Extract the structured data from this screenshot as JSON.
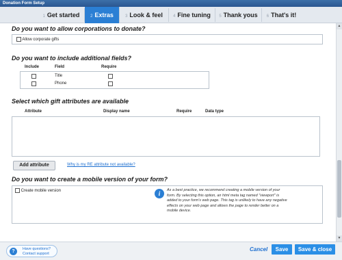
{
  "window": {
    "title": "Donation Form Setup"
  },
  "tabs": [
    {
      "num": "1",
      "label": "Get started"
    },
    {
      "num": "2",
      "label": "Extras"
    },
    {
      "num": "3",
      "label": "Look & feel"
    },
    {
      "num": "4",
      "label": "Fine tuning"
    },
    {
      "num": "5",
      "label": "Thank yous"
    },
    {
      "num": "6",
      "label": "That's it!"
    }
  ],
  "active_tab": "Extras",
  "corporations": {
    "question": "Do you want to allow corporations to donate?",
    "checkbox_label": "Allow corporate gifts",
    "checked": false
  },
  "fields": {
    "question": "Do you want to include additional fields?",
    "headers": {
      "include": "Include",
      "field": "Field",
      "require": "Require"
    },
    "rows": [
      {
        "field": "Title",
        "include": false,
        "require": false
      },
      {
        "field": "Phone",
        "include": false,
        "require": false
      }
    ]
  },
  "gift_attributes": {
    "question": "Select which gift attributes are available",
    "headers": {
      "attribute": "Attribute",
      "display_name": "Display name",
      "require": "Require",
      "data_type": "Data type"
    },
    "add_button": "Add attribute",
    "help_link": "Why is my RE attribute not available?"
  },
  "mobile": {
    "question": "Do you want to create a mobile version of your form?",
    "checkbox_label": "Create mobile version",
    "checked": false,
    "info_text": "As a best practice, we recommend creating a mobile version of your form. By selecting this option, an html meta tag named \"viewport\" is added to your form's web page. This tag is unlikely to have any negative effects on your web page and allows the page to render better on a mobile device."
  },
  "footer": {
    "help_line1": "Have questions?",
    "help_line2": "Contact support",
    "cancel": "Cancel",
    "save": "Save",
    "save_close": "Save & close"
  },
  "colors": {
    "accent": "#2b7fd4",
    "link": "#1d6fd0"
  },
  "icons": [
    "help-icon",
    "info-icon"
  ]
}
